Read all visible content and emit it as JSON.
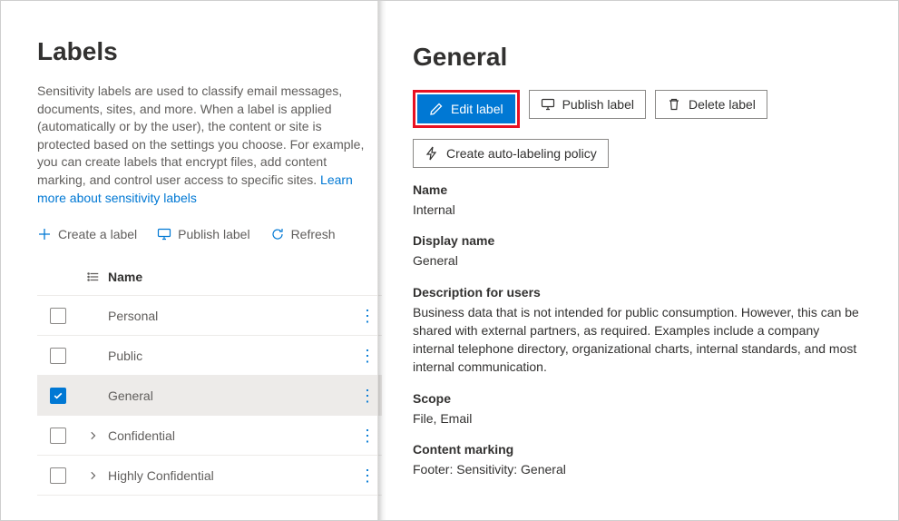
{
  "page": {
    "title": "Labels",
    "intro_text": "Sensitivity labels are used to classify email messages, documents, sites, and more. When a label is applied (automatically or by the user), the content or site is protected based on the settings you choose. For example, you can create labels that encrypt files, add content marking, and control user access to specific sites. ",
    "intro_link": "Learn more about sensitivity labels"
  },
  "toolbar": {
    "create": "Create a label",
    "publish": "Publish label",
    "refresh": "Refresh"
  },
  "table": {
    "header_name": "Name",
    "rows": [
      {
        "name": "Personal",
        "expandable": false,
        "checked": false
      },
      {
        "name": "Public",
        "expandable": false,
        "checked": false
      },
      {
        "name": "General",
        "expandable": false,
        "checked": true
      },
      {
        "name": "Confidential",
        "expandable": true,
        "checked": false
      },
      {
        "name": "Highly Confidential",
        "expandable": true,
        "checked": false
      }
    ]
  },
  "detail": {
    "title": "General",
    "buttons": {
      "edit": "Edit label",
      "publish": "Publish label",
      "delete": "Delete label",
      "auto": "Create auto-labeling policy"
    },
    "fields": {
      "name_label": "Name",
      "name_value": "Internal",
      "display_label": "Display name",
      "display_value": "General",
      "desc_label": "Description for users",
      "desc_value": "Business data that is not intended for public consumption. However, this can be shared with external partners, as required. Examples include a company internal telephone directory, organizational charts, internal standards, and most internal communication.",
      "scope_label": "Scope",
      "scope_value": "File, Email",
      "marking_label": "Content marking",
      "marking_value": "Footer: Sensitivity: General"
    }
  }
}
